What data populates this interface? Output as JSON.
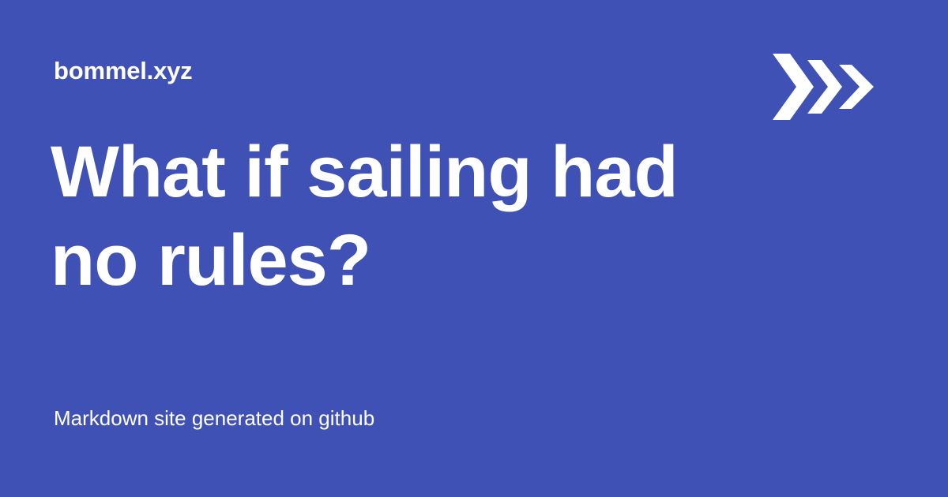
{
  "site": {
    "name": "bommel.xyz"
  },
  "article": {
    "title": "What if sailing had no rules?"
  },
  "footer": {
    "note": "Markdown site generated on github"
  },
  "logo": {
    "icon": "chevrons-right-icon"
  },
  "colors": {
    "background": "#3f51b5",
    "text": "#ffffff"
  }
}
